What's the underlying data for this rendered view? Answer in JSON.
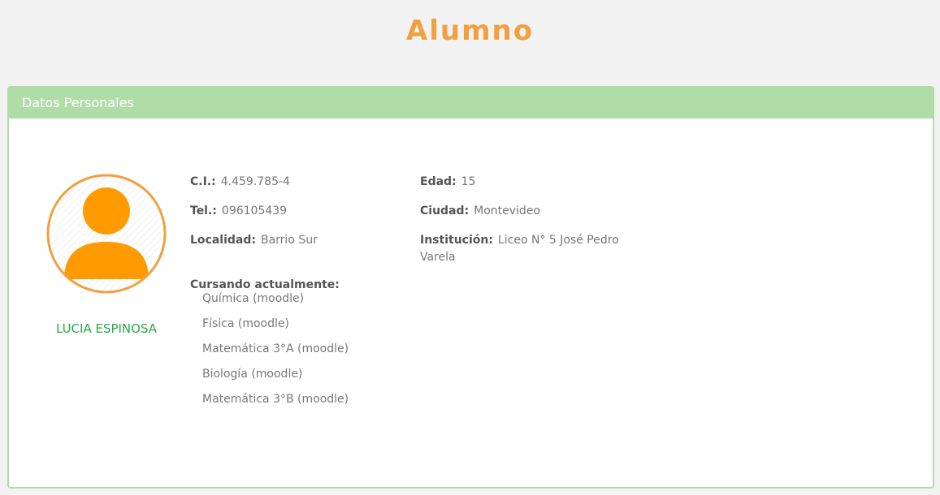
{
  "page": {
    "title": "Alumno"
  },
  "panel": {
    "header": "Datos Personales"
  },
  "student": {
    "name": "LUCIA ESPINOSA",
    "ci_label": "C.I.:",
    "ci_value": "4.459.785-4",
    "tel_label": "Tel.:",
    "tel_value": "096105439",
    "localidad_label": "Localidad:",
    "localidad_value": "Barrio Sur",
    "edad_label": "Edad:",
    "edad_value": "15",
    "ciudad_label": "Ciudad:",
    "ciudad_value": "Montevideo",
    "institucion_label": "Institución:",
    "institucion_value": "Liceo N° 5 José Pedro Varela",
    "cursando_label": "Cursando actualmente:",
    "courses": [
      "Química (moodle)",
      "Física (moodle)",
      "Matemática 3°A (moodle)",
      "Biología (moodle)",
      "Matemática 3°B (moodle)"
    ]
  },
  "icons": {
    "avatar": "user-avatar-icon"
  },
  "colors": {
    "title": "#f0a040",
    "panel_border": "#b0dca8",
    "avatar": "#ff9a00",
    "name": "#28a745"
  }
}
